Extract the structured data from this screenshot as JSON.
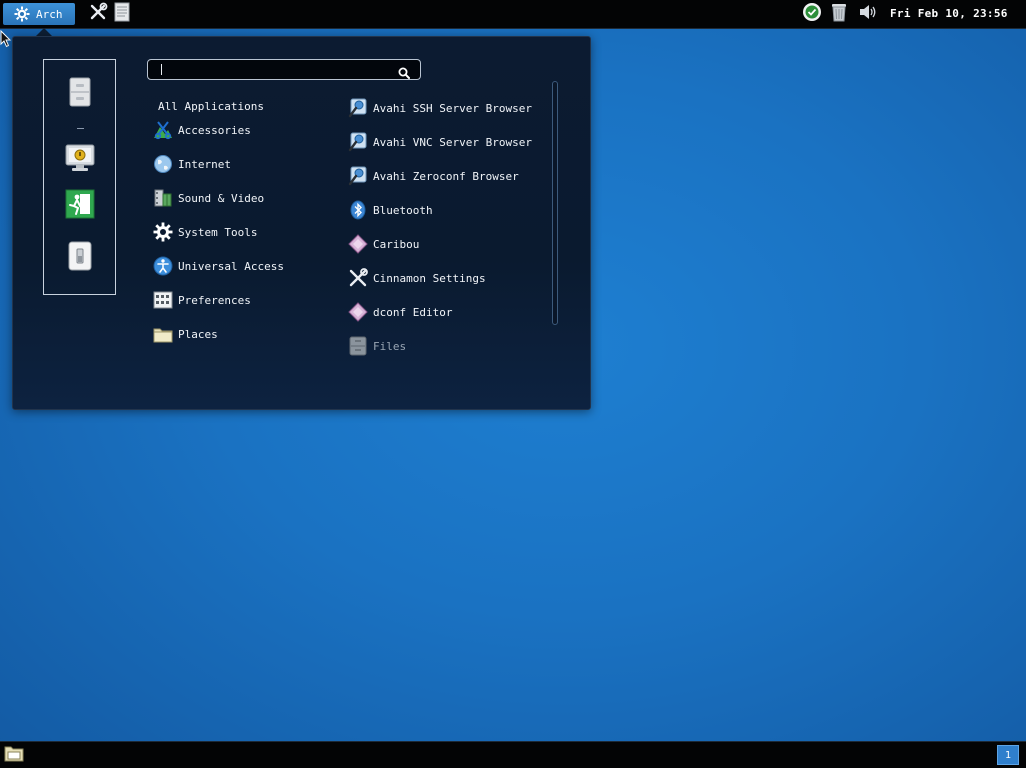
{
  "top_panel": {
    "menu_button_label": "Arch",
    "launchers": [
      "cinnamon-settings-icon",
      "text-editor-icon"
    ],
    "tray_icons": [
      "update-manager-icon",
      "trash-icon",
      "volume-icon"
    ],
    "clock": "Fri Feb 10, 23:56"
  },
  "menu": {
    "search": {
      "value": "",
      "placeholder": ""
    },
    "favorites": [
      "file-cabinet-icon",
      "lock-screen-icon",
      "logout-icon",
      "shutdown-icon"
    ],
    "categories": [
      {
        "label": "All Applications",
        "icon": ""
      },
      {
        "label": "Accessories",
        "icon": "accessories-icon"
      },
      {
        "label": "Internet",
        "icon": "internet-globe-icon"
      },
      {
        "label": "Sound & Video",
        "icon": "film-reel-icon"
      },
      {
        "label": "System Tools",
        "icon": "gear-icon"
      },
      {
        "label": "Universal Access",
        "icon": "accessibility-icon"
      },
      {
        "label": "Preferences",
        "icon": "preferences-icon"
      },
      {
        "label": "Places",
        "icon": "folder-icon"
      }
    ],
    "applications": [
      {
        "label": "Avahi SSH Server Browser",
        "icon": "network-search-icon"
      },
      {
        "label": "Avahi VNC Server Browser",
        "icon": "network-search-icon"
      },
      {
        "label": "Avahi Zeroconf Browser",
        "icon": "network-search-icon"
      },
      {
        "label": "Bluetooth",
        "icon": "bluetooth-icon"
      },
      {
        "label": "Caribou",
        "icon": "diamond-icon"
      },
      {
        "label": "Cinnamon Settings",
        "icon": "tools-icon"
      },
      {
        "label": "dconf Editor",
        "icon": "diamond-icon"
      },
      {
        "label": "Files",
        "icon": "file-cabinet-icon"
      }
    ]
  },
  "bottom_panel": {
    "workspace_number": "1"
  },
  "colors": {
    "desktop": "#1a72c2",
    "panel": "#030405",
    "menu_bg": "#0c1b31",
    "accent": "#2f7fcc"
  }
}
